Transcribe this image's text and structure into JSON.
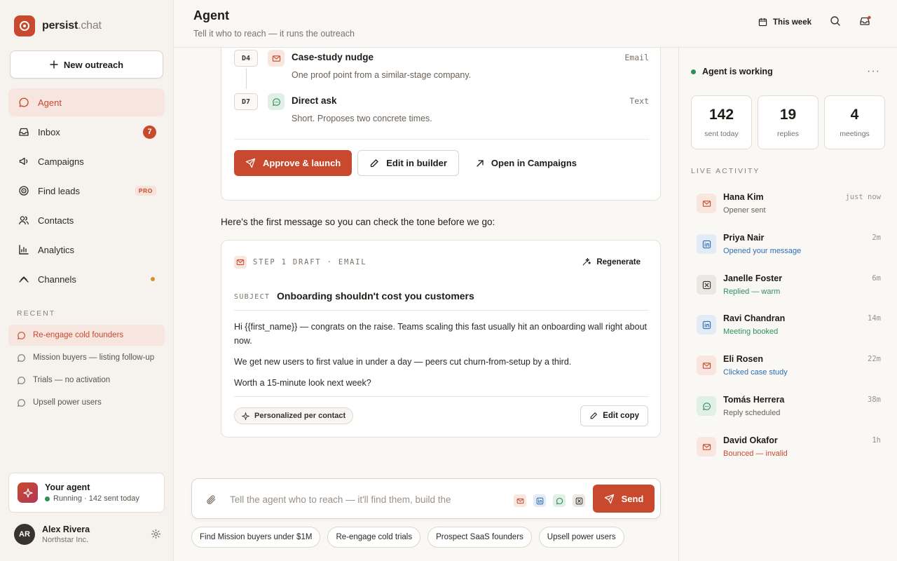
{
  "brand": {
    "name": "persist",
    "tld": ".chat"
  },
  "sidebar": {
    "new_button": "New outreach",
    "nav": [
      {
        "label": "Agent",
        "icon": "chat-bubble-icon",
        "active": true
      },
      {
        "label": "Inbox",
        "icon": "inbox-icon",
        "badge": "7"
      },
      {
        "label": "Campaigns",
        "icon": "megaphone-icon"
      },
      {
        "label": "Find leads",
        "icon": "target-icon",
        "tag": "PRO"
      },
      {
        "label": "Contacts",
        "icon": "users-icon"
      },
      {
        "label": "Analytics",
        "icon": "bar-chart-icon"
      },
      {
        "label": "Channels",
        "icon": "channels-icon",
        "dot": true
      }
    ],
    "recent_heading": "RECENT",
    "recent": [
      {
        "label": "Re-engage cold founders",
        "active": true
      },
      {
        "label": "Mission buyers — listing follow-up"
      },
      {
        "label": "Trials — no activation"
      },
      {
        "label": "Upsell power users"
      }
    ],
    "agent_card": {
      "title": "Your agent",
      "status": "Running · 142 sent today"
    },
    "user": {
      "initials": "AR",
      "name": "Alex Rivera",
      "org": "Northstar Inc."
    }
  },
  "header": {
    "title": "Agent",
    "subtitle": "Tell it who to reach — it runs the outreach",
    "period": "This week"
  },
  "plan": {
    "steps": [
      {
        "day": "D4",
        "name": "Case-study nudge",
        "desc": "One proof point from a similar-stage company.",
        "type": "Email",
        "channel": "email"
      },
      {
        "day": "D7",
        "name": "Direct ask",
        "desc": "Short. Proposes two concrete times.",
        "type": "Text",
        "channel": "text"
      }
    ],
    "approve": "Approve & launch",
    "edit": "Edit in builder",
    "open": "Open in Campaigns"
  },
  "intro": "Here's the first message so you can check the tone before we go:",
  "draft": {
    "header": "STEP 1 DRAFT · EMAIL",
    "regenerate": "Regenerate",
    "subject_label": "SUBJECT",
    "subject": "Onboarding shouldn't cost you customers",
    "body": [
      "Hi {{first_name}} — congrats on the raise. Teams scaling this fast usually hit an onboarding wall right about now.",
      "We get new users to first value in under a day — peers cut churn-from-setup by a third.",
      "Worth a 15-minute look next week?"
    ],
    "personalized": "Personalized per contact",
    "edit_copy": "Edit copy"
  },
  "composer": {
    "placeholder": "Tell the agent who to reach — it'll find them, build the",
    "send": "Send",
    "channels": [
      "email",
      "linkedin",
      "text",
      "x"
    ]
  },
  "suggestions": [
    "Find Mission buyers under $1M",
    "Re-engage cold trials",
    "Prospect SaaS founders",
    "Upsell power users"
  ],
  "panel": {
    "status": "Agent is working",
    "stats": [
      {
        "value": "142",
        "label": "sent today"
      },
      {
        "value": "19",
        "label": "replies"
      },
      {
        "value": "4",
        "label": "meetings"
      }
    ],
    "live_heading": "LIVE ACTIVITY",
    "activity": [
      {
        "name": "Hana Kim",
        "status": "Opener sent",
        "time": "just now",
        "channel": "email",
        "tone": "grey"
      },
      {
        "name": "Priya Nair",
        "status": "Opened your message",
        "time": "2m",
        "channel": "linkedin",
        "tone": "blue"
      },
      {
        "name": "Janelle Foster",
        "status": "Replied — warm",
        "time": "6m",
        "channel": "x",
        "tone": "green"
      },
      {
        "name": "Ravi Chandran",
        "status": "Meeting booked",
        "time": "14m",
        "channel": "linkedin",
        "tone": "green"
      },
      {
        "name": "Eli Rosen",
        "status": "Clicked case study",
        "time": "22m",
        "channel": "email",
        "tone": "blue"
      },
      {
        "name": "Tomás Herrera",
        "status": "Reply scheduled",
        "time": "38m",
        "channel": "text",
        "tone": "grey"
      },
      {
        "name": "David Okafor",
        "status": "Bounced — invalid",
        "time": "1h",
        "channel": "email",
        "tone": "red"
      }
    ]
  },
  "colors": {
    "accent": "#c8492d",
    "success": "#2f8f5b",
    "info": "#2f6db5"
  }
}
